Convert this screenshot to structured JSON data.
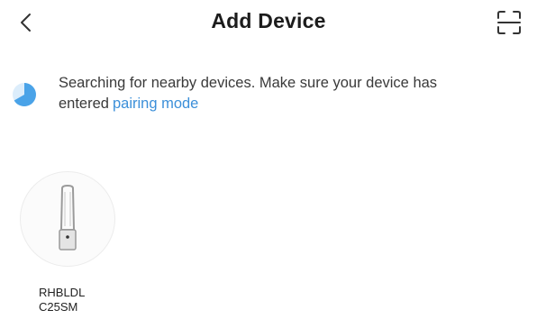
{
  "header": {
    "title": "Add Device",
    "back_icon": "chevron-left-icon",
    "scan_icon": "scan-icon"
  },
  "status": {
    "message": "Searching for nearby devices. Make sure your device has entered",
    "link_label": "pairing mode",
    "spinner_icon": "loading-spinner-icon",
    "link_color": "#3b8fd9",
    "spinner_color": "#4aa3e8"
  },
  "devices": [
    {
      "name": "RHBLDL\nC25SM",
      "icon": "tower-fan-icon"
    }
  ]
}
